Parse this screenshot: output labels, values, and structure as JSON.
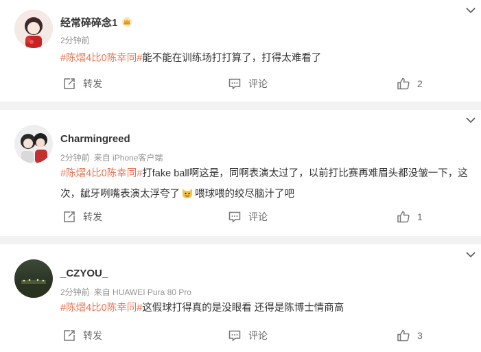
{
  "posts": [
    {
      "username": "经常碎碎念1",
      "badge": "crown-badge",
      "time": "2分钟前",
      "source": "",
      "hashtag": "#陈熠4比0陈幸同#",
      "text": "能不能在训练场打打算了，打得太难看了",
      "text_b": "",
      "repost_label": "转发",
      "comment_label": "评论",
      "like_count": "2"
    },
    {
      "username": "Charmingreed",
      "time": "2分钟前",
      "source": "来自 iPhone客户端",
      "hashtag": "#陈熠4比0陈幸同#",
      "text": "打fake ball啊这是，同啊表演太过了，以前打比赛再难眉头都没皱一下，这次，龇牙咧嘴表演太浮夸了",
      "text_b": "喂球喂的绞尽脑汁了吧",
      "repost_label": "转发",
      "comment_label": "评论",
      "like_count": "1"
    },
    {
      "username": "_CZYOU_",
      "time": "2分钟前",
      "source": "来自 HUAWEI Pura 80 Pro",
      "hashtag": "#陈熠4比0陈幸同#",
      "text": "这假球打得真的是没眼看 还得是陈博士情商高",
      "text_b": "",
      "repost_label": "转发",
      "comment_label": "评论",
      "like_count": "3"
    }
  ],
  "colors": {
    "hashtag": "#eb7350",
    "meta": "#939393",
    "action": "#666666"
  },
  "icons": {
    "menu": "chevron-down-icon",
    "repost": "repost-icon",
    "comment": "comment-icon",
    "like": "thumbs-up-icon",
    "emoji": "cat-face-emoji-icon"
  }
}
